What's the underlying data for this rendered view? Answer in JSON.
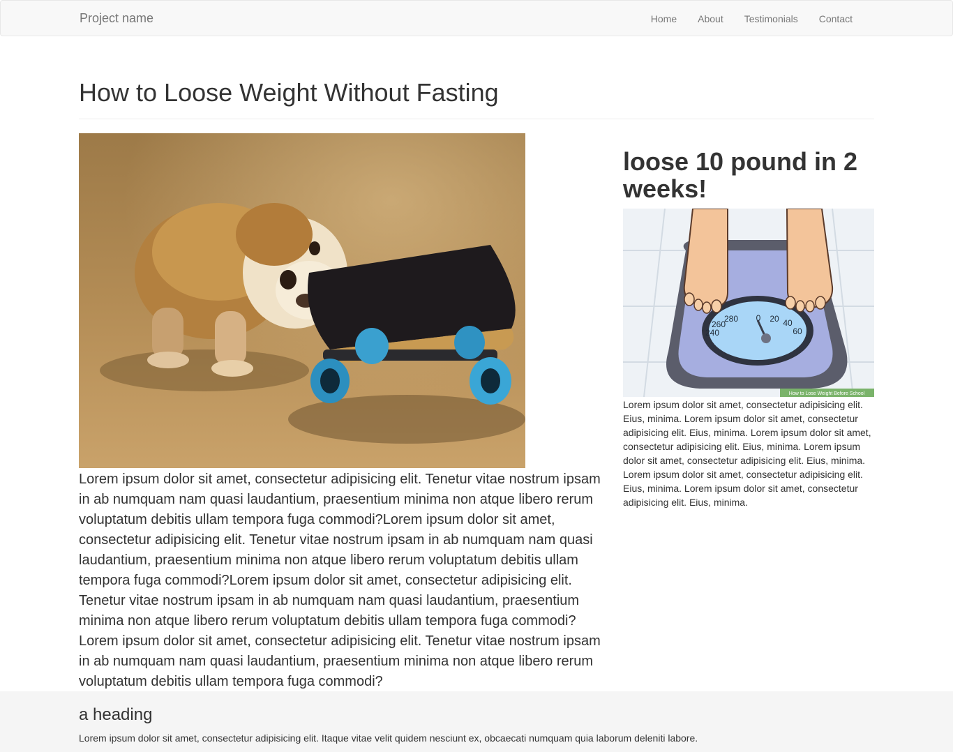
{
  "navbar": {
    "brand": "Project name",
    "links": [
      "Home",
      "About",
      "Testimonials",
      "Contact"
    ]
  },
  "main": {
    "title": "How to Loose Weight Without Fasting",
    "image_icon": "bulldog-puppy-skateboard-photo",
    "body": "Lorem ipsum dolor sit amet, consectetur adipisicing elit. Tenetur vitae nostrum ipsam in ab numquam nam quasi laudantium, praesentium minima non atque libero rerum voluptatum debitis ullam tempora fuga commodi?Lorem ipsum dolor sit amet, consectetur adipisicing elit. Tenetur vitae nostrum ipsam in ab numquam nam quasi laudantium, praesentium minima non atque libero rerum voluptatum debitis ullam tempora fuga commodi?Lorem ipsum dolor sit amet, consectetur adipisicing elit. Tenetur vitae nostrum ipsam in ab numquam nam quasi laudantium, praesentium minima non atque libero rerum voluptatum debitis ullam tempora fuga commodi?Lorem ipsum dolor sit amet, consectetur adipisicing elit. Tenetur vitae nostrum ipsam in ab numquam nam quasi laudantium, praesentium minima non atque libero rerum voluptatum debitis ullam tempora fuga commodi?"
  },
  "sidebar": {
    "title": "loose 10 pound in 2 weeks!",
    "image_icon": "bathroom-scale-illustration",
    "scale_numbers": [
      "280",
      "0",
      "20",
      "40",
      "60",
      "260",
      "240"
    ],
    "watermark": "How to Lose Weight Before School",
    "body": "Lorem ipsum dolor sit amet, consectetur adipisicing elit. Eius, minima. Lorem ipsum dolor sit amet, consectetur adipisicing elit. Eius, minima. Lorem ipsum dolor sit amet, consectetur adipisicing elit. Eius, minima. Lorem ipsum dolor sit amet, consectetur adipisicing elit. Eius, minima. Lorem ipsum dolor sit amet, consectetur adipisicing elit. Eius, minima. Lorem ipsum dolor sit amet, consectetur adipisicing elit. Eius, minima."
  },
  "footer": {
    "heading": "a heading",
    "text": "Lorem ipsum dolor sit amet, consectetur adipisicing elit. Itaque vitae velit quidem nesciunt ex, obcaecati numquam quia laborum deleniti labore."
  }
}
